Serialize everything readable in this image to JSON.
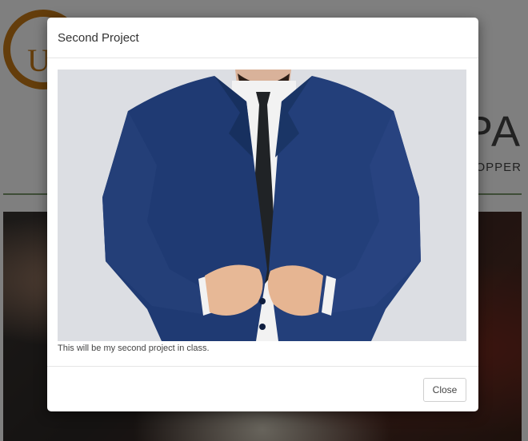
{
  "background": {
    "logo_letter": "U",
    "heading": "PA",
    "subheading": "LOPPER"
  },
  "modal": {
    "title": "Second Project",
    "caption": "This will be my second project in class.",
    "close_label": "Close",
    "image_icon": "project-photo-suit"
  },
  "colors": {
    "logo_accent": "#c97b17",
    "divider": "#7d9a6e",
    "suit": "#1f3a73"
  }
}
